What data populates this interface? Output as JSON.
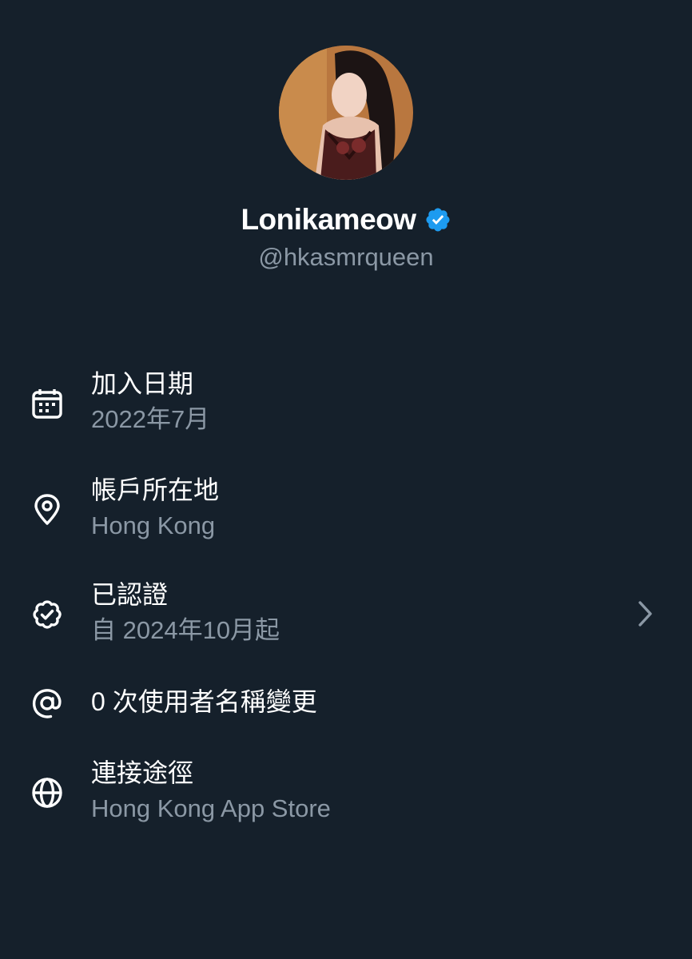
{
  "profile": {
    "display_name": "Lonikameow",
    "handle": "@hkasmrqueen",
    "verified_badge_color": "#1d9bf0",
    "avatar_icon": "profile-photo"
  },
  "colors": {
    "background": "#15202b",
    "primary_text": "#ffffff",
    "secondary_text": "#8b98a5",
    "accent": "#1d9bf0"
  },
  "info": {
    "joined": {
      "icon": "calendar-icon",
      "title": "加入日期",
      "value": "2022年7月"
    },
    "location": {
      "icon": "location-pin-icon",
      "title": "帳戶所在地",
      "value": "Hong Kong"
    },
    "verified": {
      "icon": "verified-badge-icon",
      "title": "已認證",
      "value": "自 2024年10月起",
      "has_chevron": true
    },
    "username_changes": {
      "icon": "at-icon",
      "title": "0 次使用者名稱變更"
    },
    "connected_via": {
      "icon": "globe-icon",
      "title": "連接途徑",
      "value": "Hong Kong App Store"
    }
  }
}
